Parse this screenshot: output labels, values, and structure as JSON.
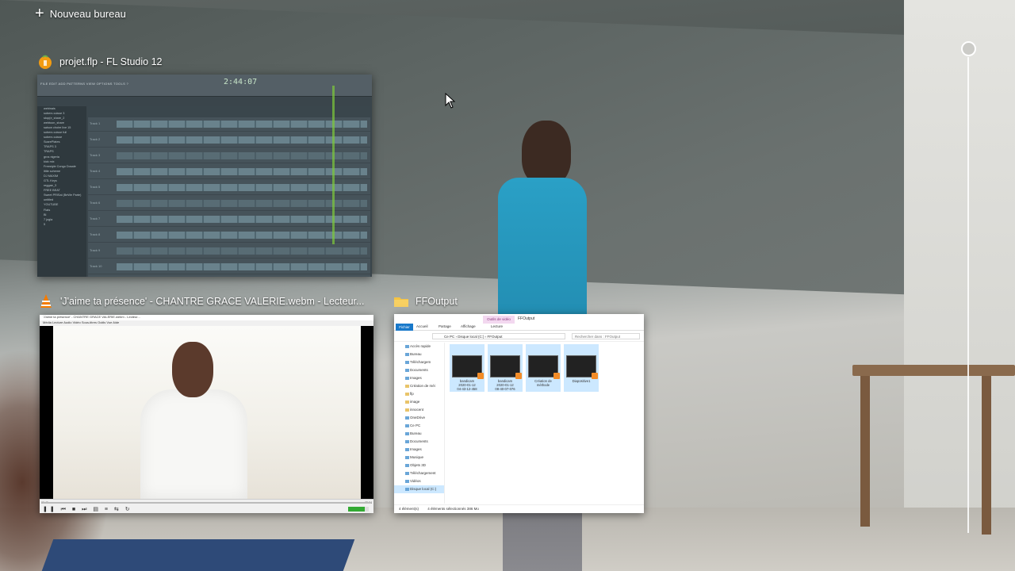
{
  "task_view": {
    "new_desktop_label": "Nouveau bureau"
  },
  "windows": [
    {
      "id": "fl-studio",
      "title": "projet.flp - FL Studio 12",
      "icon": "fl-studio-icon",
      "preview": {
        "menu": "FILE EDIT ADD PATTERNS VIEW OPTIONS TOOLS ?",
        "time": "2:44:07",
        "browser_items": [
          "webinais",
          "sobers cuisse 3",
          "stop(e_share_2",
          "webtoon_share",
          "saison choire live 15",
          "sobers cuisse full",
          "sobers cuisse",
          "ScarePlates",
          "TRAPS 3",
          "TRAPS",
          "gros nigeria",
          "kick mix",
          "Freestyle Congo Dosale",
          "little scheme",
          "DJ MAXIM",
          "GTL Keys",
          "reggae_3",
          "FREE BEAT",
          "Sweet PRISal (BeWe Parte)",
          "untitled",
          "YOUTUBE",
          "Flats",
          "Bl",
          "7 jogla",
          "5"
        ],
        "tracks": [
          "Track 1",
          "Track 2",
          "Track 3",
          "Track 4",
          "Track 5",
          "Track 6",
          "Track 7",
          "Track 8",
          "Track 9",
          "Track 10"
        ]
      }
    },
    {
      "id": "vlc",
      "title": "'J'aime ta présence' - CHANTRE GRACE VALERIE.webm - Lecteur...",
      "icon": "vlc-icon",
      "preview": {
        "menu": "Média  Lecture  Audio  Vidéo  Sous-titres  Outils  Vue  Aide",
        "time_elapsed": "00:49",
        "time_total": "05:04"
      }
    },
    {
      "id": "explorer",
      "title": "FFOutput",
      "icon": "folder-icon",
      "preview": {
        "context_tab": "Outils de vidéo",
        "window_name": "FFOutput",
        "ribbon_tabs": [
          "Fichier",
          "Accueil",
          "Partage",
          "Affichage",
          "Lecture"
        ],
        "address": "Ce PC  ›  Disque local (C:)  ›  FFOutput",
        "search_placeholder": "Rechercher dans : FFOutput",
        "nav_items": [
          "Accès rapide",
          "Bureau",
          "Téléchargem",
          "Documents",
          "Images",
          "Création de méi",
          "flp",
          "image",
          "innocent",
          "OneDrive",
          "Ce PC",
          "Bureau",
          "Documents",
          "Images",
          "Musique",
          "Objets 3D",
          "Téléchargement",
          "Vidéos",
          "Disque local (C:)"
        ],
        "files": [
          {
            "name": "bandicam\n2020-01-12\n04-43-12-458",
            "selected": true
          },
          {
            "name": "bandicam\n2020-01-12\n08-40-07-076",
            "selected": true
          },
          {
            "name": "Création de\nméthode",
            "selected": true
          },
          {
            "name": "Diapositive1",
            "selected": true
          }
        ],
        "status_count": "4 élément(s)",
        "status_selected": "4 éléments sélectionnés 386 Mo"
      }
    }
  ],
  "colors": {
    "accent_blue": "#1979ca",
    "selection": "#cce8ff"
  }
}
